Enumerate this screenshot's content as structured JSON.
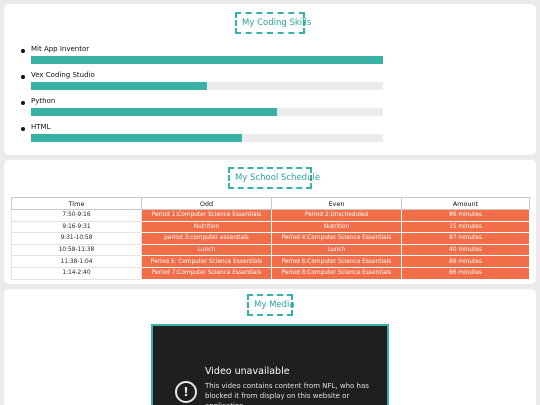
{
  "skills": {
    "title": "My Coding Skills",
    "items": [
      {
        "name": "Mit App Inventor",
        "level_percent": 100
      },
      {
        "name": "Vex Coding Studio",
        "level_percent": 50
      },
      {
        "name": "Python",
        "level_percent": 70
      },
      {
        "name": "HTML",
        "level_percent": 60
      }
    ]
  },
  "schedule": {
    "title": "My School Schedule",
    "headers": [
      "Time",
      "Odd",
      "Even",
      "Amount"
    ],
    "rows": [
      [
        "7:50-9:16",
        "Period 1:Computer Science Essentials",
        "Period 2:Unscheduled",
        "86 minutes"
      ],
      [
        "9:16-9:31",
        "Nutrition",
        "Nutrition",
        "15 minutes"
      ],
      [
        "9:31-10:58",
        "period 3:computer essentials",
        "Period 4:Computer Science Essentials",
        "87 minutes"
      ],
      [
        "10:58-11:38",
        "Lunch",
        "Lunch",
        "40 minutes"
      ],
      [
        "11:38-1:04",
        "Period 5: Computer Science Essentials",
        "Period 6:Computer Science Essentials",
        "86 minutes"
      ],
      [
        "1:14-2:40",
        "Period 7:Computer Science Essentials",
        "Period 8:Computer Science Essentials",
        "86 minutes"
      ]
    ]
  },
  "media": {
    "title": "My Media",
    "video": {
      "title": "Video unavailable",
      "message": "This video contains content from NFL, who has blocked it from display on this website or application."
    }
  },
  "colors": {
    "accent": "#3ab1a5",
    "highlight": "#f26e48"
  }
}
